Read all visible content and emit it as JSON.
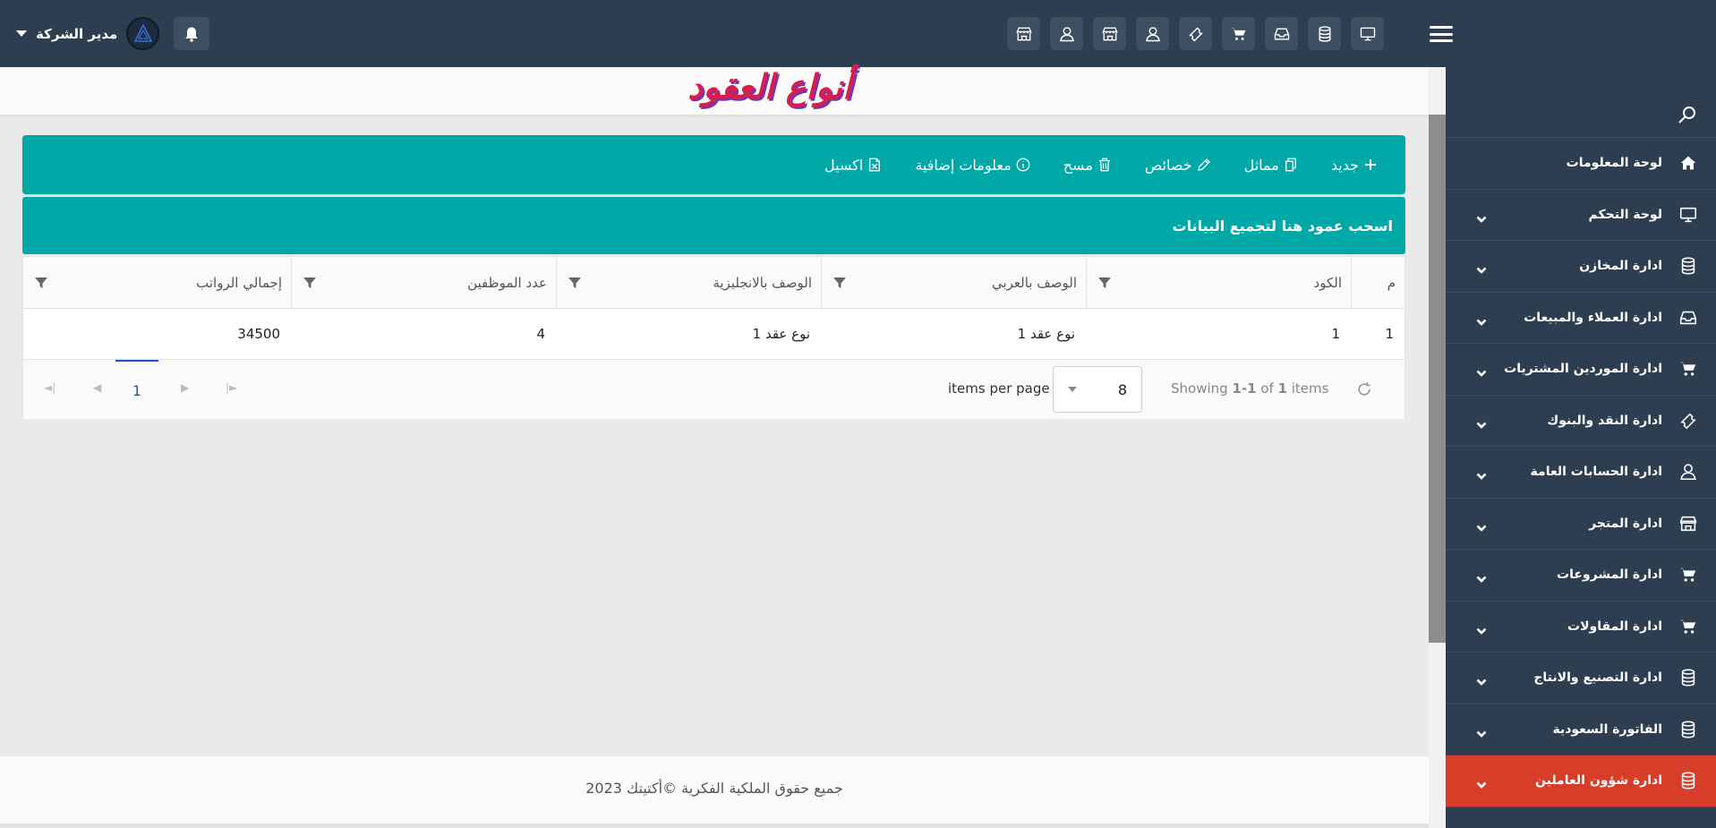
{
  "header": {
    "user_name": "مدير الشركة",
    "quick_icons": [
      "monitor-icon",
      "database-icon",
      "inbox-icon",
      "cart-icon",
      "ticket-icon",
      "user-icon",
      "store-icon",
      "user-icon",
      "store-icon"
    ]
  },
  "sidebar": {
    "items": [
      {
        "label": "لوحة المعلومات",
        "icon": "home-icon",
        "expandable": false
      },
      {
        "label": "لوحة التحكم",
        "icon": "monitor-icon",
        "expandable": true
      },
      {
        "label": "ادارة المخازن",
        "icon": "database-icon",
        "expandable": true
      },
      {
        "label": "ادارة العملاء والمبيعات",
        "icon": "inbox-icon",
        "expandable": true
      },
      {
        "label": "ادارة الموردين المشتريات",
        "icon": "cart-icon",
        "expandable": true
      },
      {
        "label": "ادارة النقد والبنوك",
        "icon": "ticket-icon",
        "expandable": true
      },
      {
        "label": "ادارة الحسابات العامة",
        "icon": "user-icon",
        "expandable": true
      },
      {
        "label": "ادارة المتجر",
        "icon": "store-icon",
        "expandable": true
      },
      {
        "label": "ادارة المشروعات",
        "icon": "cart-icon",
        "expandable": true
      },
      {
        "label": "ادارة المقاولات",
        "icon": "cart-icon",
        "expandable": true
      },
      {
        "label": "ادارة التصنيع والانتاج",
        "icon": "database-icon",
        "expandable": true
      },
      {
        "label": "الفاتورة السعودية",
        "icon": "database-icon",
        "expandable": true
      },
      {
        "label": "ادارة شؤون العاملين",
        "icon": "database-icon",
        "expandable": true,
        "active": true
      }
    ],
    "active_color": "#d63e2a"
  },
  "page": {
    "title": "أنواع العقود"
  },
  "toolbar": {
    "new_label": "جديد",
    "similar_label": "مماثل",
    "properties_label": "خصائص",
    "delete_label": "مسح",
    "more_info_label": "معلومات إضافية",
    "excel_label": "اكسيل",
    "accent_color": "#00a8a8"
  },
  "grid": {
    "group_hint": "اسحب عمود هنا لتجميع البيانات",
    "columns": {
      "index": "م",
      "code": "الكود",
      "desc_ar": "الوصف بالعربي",
      "desc_en": "الوصف بالانجليزية",
      "employees": "عدد الموظفين",
      "total_salaries": "إجمالي الرواتب"
    },
    "rows": [
      {
        "index": "1",
        "code": "1",
        "desc_ar": "نوع عقد 1",
        "desc_en": "نوع عقد 1",
        "employees": "4",
        "total_salaries": "34500"
      }
    ]
  },
  "pager": {
    "current_page": "1",
    "items_per_page_label": "items per page",
    "page_size": "8",
    "showing_prefix": "Showing ",
    "showing_range": "1-1",
    "showing_of": " of ",
    "showing_total": "1",
    "showing_suffix": " items"
  },
  "footer": {
    "text": "جميع حقوق الملكية الفكرية ©أكتيتك 2023"
  }
}
